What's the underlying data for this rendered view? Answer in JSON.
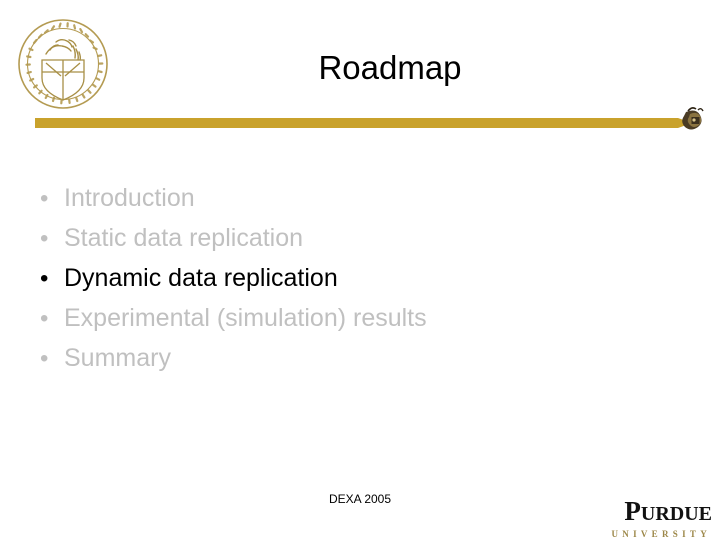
{
  "slide": {
    "title": "Roadmap",
    "logo_alt": "purdue-seal",
    "accent_gold": "#c9a22c",
    "dim_color": "#c0c0c0",
    "active_color": "#000000",
    "bullets": [
      {
        "text": "Introduction",
        "state": "dim"
      },
      {
        "text": "Static data replication",
        "state": "dim"
      },
      {
        "text": "Dynamic data replication",
        "state": "active"
      },
      {
        "text": "Experimental (simulation) results",
        "state": "dim"
      },
      {
        "text": "Summary",
        "state": "dim"
      }
    ],
    "bullet_glyph": "•",
    "footer_note": "DEXA 2005",
    "wordmark": {
      "name_lead": "P",
      "name_rest": "URDUE",
      "subtitle": "UNIVERSITY"
    }
  }
}
